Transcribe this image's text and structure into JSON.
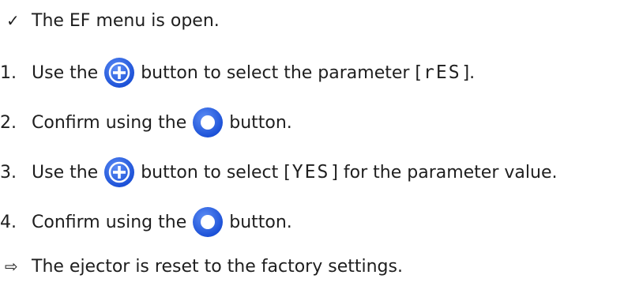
{
  "precondition": {
    "marker": "✓",
    "text": "The EF menu is open."
  },
  "steps": [
    {
      "number": "1.",
      "text_before": "Use the",
      "icon": "plus-button-icon",
      "text_after_pre": "button to select the parameter [",
      "code": "rES",
      "text_after_post": "]."
    },
    {
      "number": "2.",
      "text_before": "Confirm using the",
      "icon": "confirm-ring-button-icon",
      "text_after": "button."
    },
    {
      "number": "3.",
      "text_before": "Use the",
      "icon": "plus-button-icon",
      "text_after_pre": "button to select [",
      "code": "YES",
      "text_after_post": "] for the parameter value."
    },
    {
      "number": "4.",
      "text_before": "Confirm using the",
      "icon": "confirm-ring-button-icon",
      "text_after": "button."
    }
  ],
  "result": {
    "marker": "⇨",
    "text": "The ejector is reset to the factory settings."
  },
  "colors": {
    "icon_blue": "#1a4fd6",
    "icon_blue_light": "#5c8df5",
    "text": "#1e1e1e"
  }
}
